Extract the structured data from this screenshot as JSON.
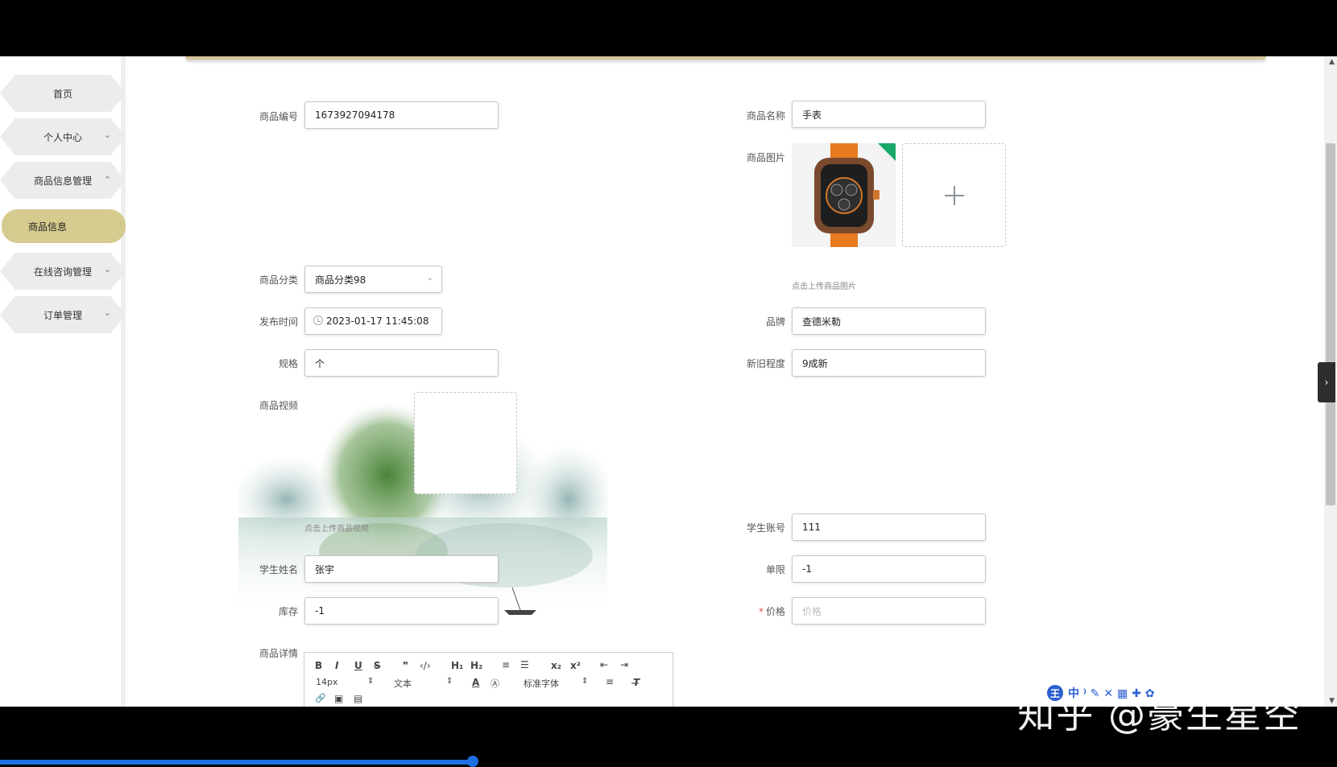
{
  "sidebar": {
    "items": [
      {
        "label": "首页"
      },
      {
        "label": "个人中心",
        "chevron": "chevron-down"
      },
      {
        "label": "商品信息管理",
        "chevron": "chevron-up"
      },
      {
        "label": "在线咨询管理",
        "chevron": "chevron-down"
      },
      {
        "label": "订单管理",
        "chevron": "chevron-down"
      }
    ],
    "active_sub": "商品信息"
  },
  "form": {
    "goods_no": {
      "label": "商品编号",
      "value": "1673927094178"
    },
    "goods_name": {
      "label": "商品名称",
      "value": "手表"
    },
    "goods_image": {
      "label": "商品图片",
      "hint": "点击上传商品图片"
    },
    "category": {
      "label": "商品分类",
      "value": "商品分类98"
    },
    "publish_time": {
      "label": "发布时间",
      "value": "2023-01-17 11:45:08"
    },
    "brand": {
      "label": "品牌",
      "value": "查德米勒"
    },
    "spec": {
      "label": "规格",
      "value": "个"
    },
    "condition": {
      "label": "新旧程度",
      "value": "9成新"
    },
    "video": {
      "label": "商品视频",
      "hint": "点击上传商品视频"
    },
    "student_account": {
      "label": "学生账号",
      "value": "111"
    },
    "student_name": {
      "label": "学生姓名",
      "value": "张宇"
    },
    "limit": {
      "label": "单限",
      "value": "-1"
    },
    "stock": {
      "label": "库存",
      "value": "-1"
    },
    "price": {
      "label": "价格",
      "placeholder": "价格",
      "required_mark": "*"
    },
    "detail": {
      "label": "商品详情"
    }
  },
  "editor": {
    "row1": [
      "B",
      "I",
      "U",
      "S",
      "❞",
      "‹/›",
      "H₁",
      "H₂",
      "≡",
      "☰",
      "x₂",
      "x²",
      "⇤",
      "⇥"
    ],
    "font_size": "14px",
    "text_type": "文本",
    "font_family": "标准字体",
    "row3": [
      "🔗",
      "▣",
      "▤"
    ]
  },
  "watermark": "知乎 @豪生星空",
  "floatbar_text": "中 ⁾ ✎ ✕ ▦ ✚ ✿",
  "floatbar_badge": "王"
}
